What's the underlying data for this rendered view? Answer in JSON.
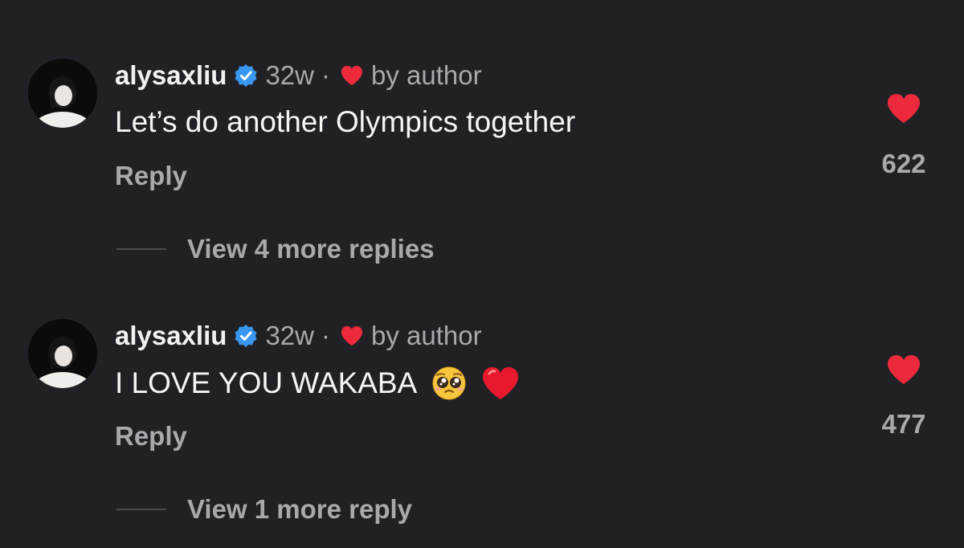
{
  "comments": [
    {
      "username": "alysaxliu",
      "time": "32w",
      "separator": "·",
      "author_like_label": "by author",
      "text": "Let’s do another Olympics together",
      "emojis": [],
      "reply_label": "Reply",
      "like_count": "622",
      "view_replies_label": "View 4 more replies"
    },
    {
      "username": "alysaxliu",
      "time": "32w",
      "separator": "·",
      "author_like_label": "by author",
      "text": "I LOVE YOU WAKABA",
      "emojis": [
        "pleading-face-icon",
        "red-heart-icon"
      ],
      "reply_label": "Reply",
      "like_count": "477",
      "view_replies_label": "View 1 more reply"
    }
  ],
  "colors": {
    "background": "#212125",
    "heart": "#ed2a3c",
    "verified": "#3897f0",
    "secondary_text": "#a8a8ad"
  }
}
